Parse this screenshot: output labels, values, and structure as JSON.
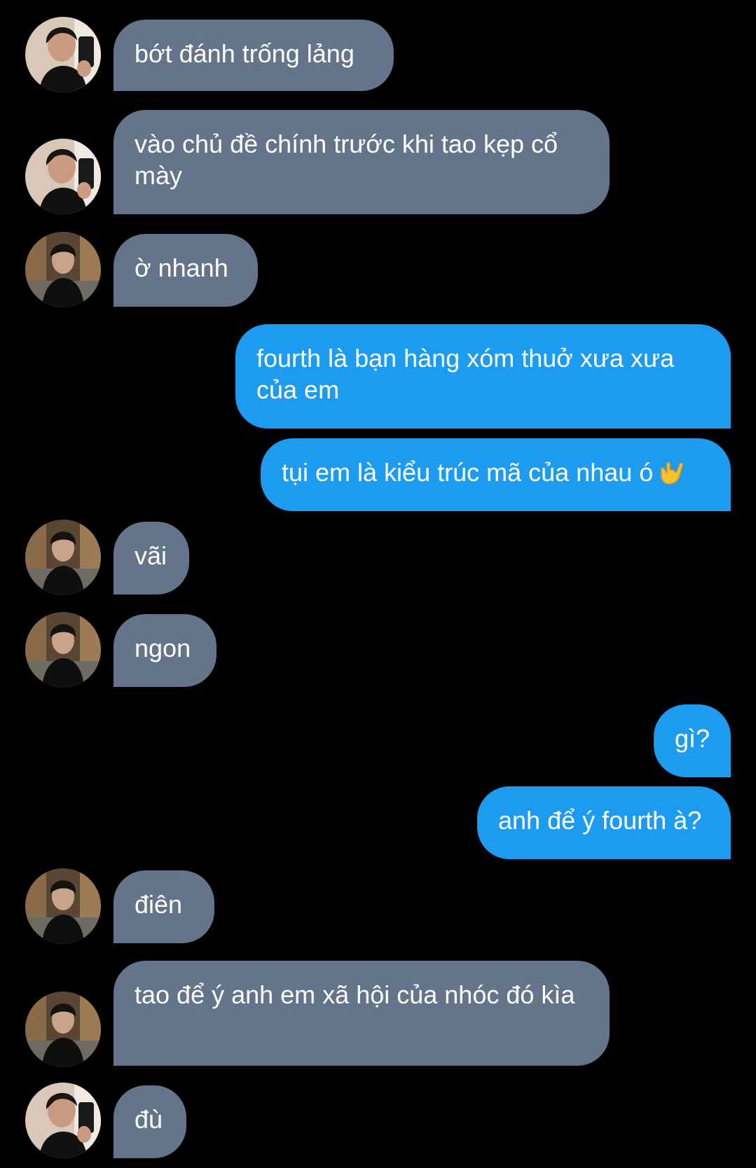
{
  "colors": {
    "background": "#000000",
    "incoming_bubble": "#64748a",
    "outgoing_bubble": "#1d9bf0",
    "text": "#ffffff"
  },
  "avatars": {
    "a": "avatar-selfie-person",
    "b": "avatar-street-person"
  },
  "messages": [
    {
      "side": "in",
      "avatar": "a",
      "text": "bớt đánh trống lảng"
    },
    {
      "side": "in",
      "avatar": "a",
      "text": "vào chủ đề chính trước khi tao kẹp cổ mày"
    },
    {
      "side": "in",
      "avatar": "b",
      "text": "ờ nhanh"
    },
    {
      "side": "out",
      "text": "fourth là bạn hàng xóm thuở xưa xưa của em"
    },
    {
      "side": "out",
      "text": "tụi em là kiểu trúc mã của nhau ó",
      "emoji": "call-me-hand-icon"
    },
    {
      "side": "in",
      "avatar": "b",
      "text": "vãi"
    },
    {
      "side": "in",
      "avatar": "b",
      "text": "ngon"
    },
    {
      "side": "out",
      "text": "gì?"
    },
    {
      "side": "out",
      "text": "anh để ý fourth à?"
    },
    {
      "side": "in",
      "avatar": "b",
      "text": "điên"
    },
    {
      "side": "in",
      "avatar": "b",
      "text": "tao để ý anh em xã hội của nhóc đó kìa"
    },
    {
      "side": "in",
      "avatar": "a",
      "text": "đù"
    }
  ]
}
